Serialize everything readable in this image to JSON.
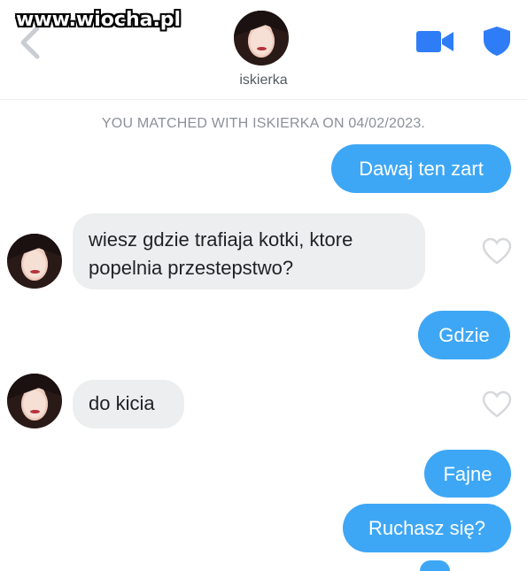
{
  "watermark": "www.wiocha.pl",
  "header": {
    "name": "iskierka",
    "video_icon": "video-camera-icon",
    "shield_icon": "shield-icon",
    "back_icon": "chevron-left-icon",
    "accent_color": "#2f7df6"
  },
  "match_notice": "YOU MATCHED WITH ISKIERKA ON 04/02/2023.",
  "messages": [
    {
      "from": "me",
      "text": "Dawaj ten zart"
    },
    {
      "from": "them",
      "lines": [
        "wiesz gdzie trafiaja kotki, ktore",
        "popelnia przestepstwo?"
      ]
    },
    {
      "from": "me",
      "text": "Gdzie"
    },
    {
      "from": "them",
      "text": "do kicia"
    },
    {
      "from": "me",
      "text": "Fajne"
    },
    {
      "from": "me",
      "text": "Ruchasz się?"
    }
  ],
  "colors": {
    "outgoing_bubble": "#3ea7f5",
    "incoming_bubble": "#eceeef"
  }
}
